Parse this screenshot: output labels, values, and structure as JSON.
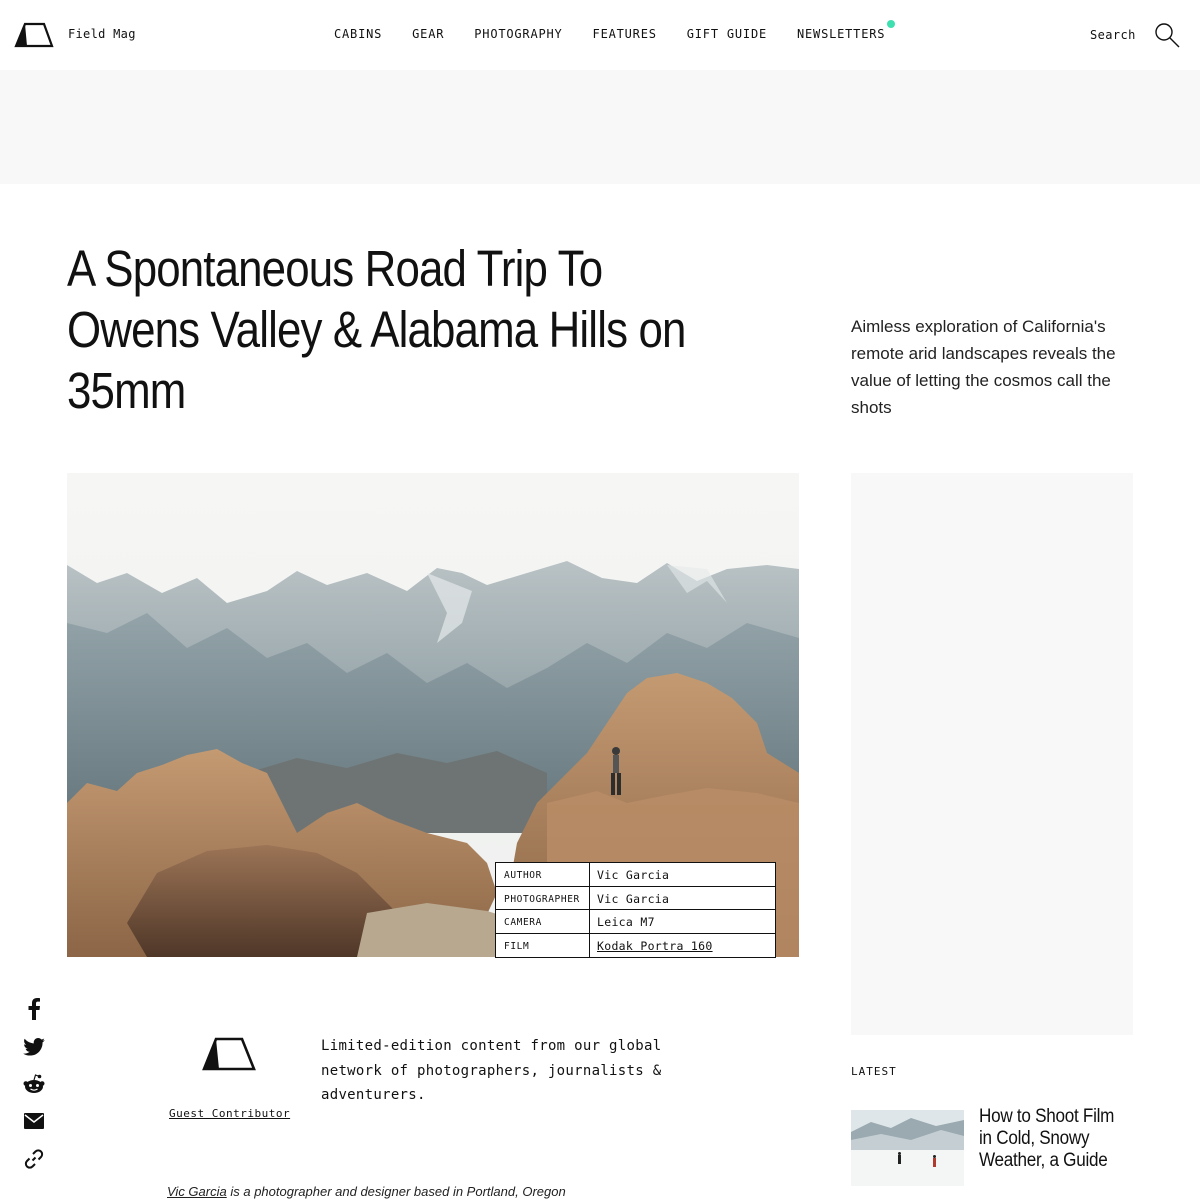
{
  "header": {
    "brand": "Field Mag",
    "nav": [
      "CABINS",
      "GEAR",
      "PHOTOGRAPHY",
      "FEATURES",
      "GIFT GUIDE",
      "NEWSLETTERS"
    ],
    "search_label": "Search"
  },
  "article": {
    "title": "A Spontaneous Road Trip To Owens Valley & Alabama Hills on 35mm",
    "dek": "Aimless exploration of California's remote arid landscapes reveals the value of letting the cosmos call the shots",
    "meta": [
      {
        "key": "AUTHOR",
        "value": "Vic Garcia"
      },
      {
        "key": "PHOTOGRAPHER",
        "value": "Vic Garcia"
      },
      {
        "key": "CAMERA",
        "value": "Leica M7"
      },
      {
        "key": "FILM",
        "value": "Kodak Portra 160"
      }
    ]
  },
  "contributor": {
    "label": "Guest Contributor",
    "text": "Limited-edition content from our global network of photographers, journalists & adventurers.",
    "bio_name": "Vic Garcia",
    "bio_rest": " is a photographer and designer based in Portland, Oregon"
  },
  "share": [
    "facebook-icon",
    "twitter-icon",
    "reddit-icon",
    "email-icon",
    "link-icon"
  ],
  "latest": {
    "label": "LATEST",
    "items": [
      {
        "title": "How to Shoot Film in Cold, Snowy Weather, a Guide"
      }
    ]
  },
  "colors": {
    "accent_dot": "#3fe0b0",
    "ad_band": "#f8f8f8"
  }
}
